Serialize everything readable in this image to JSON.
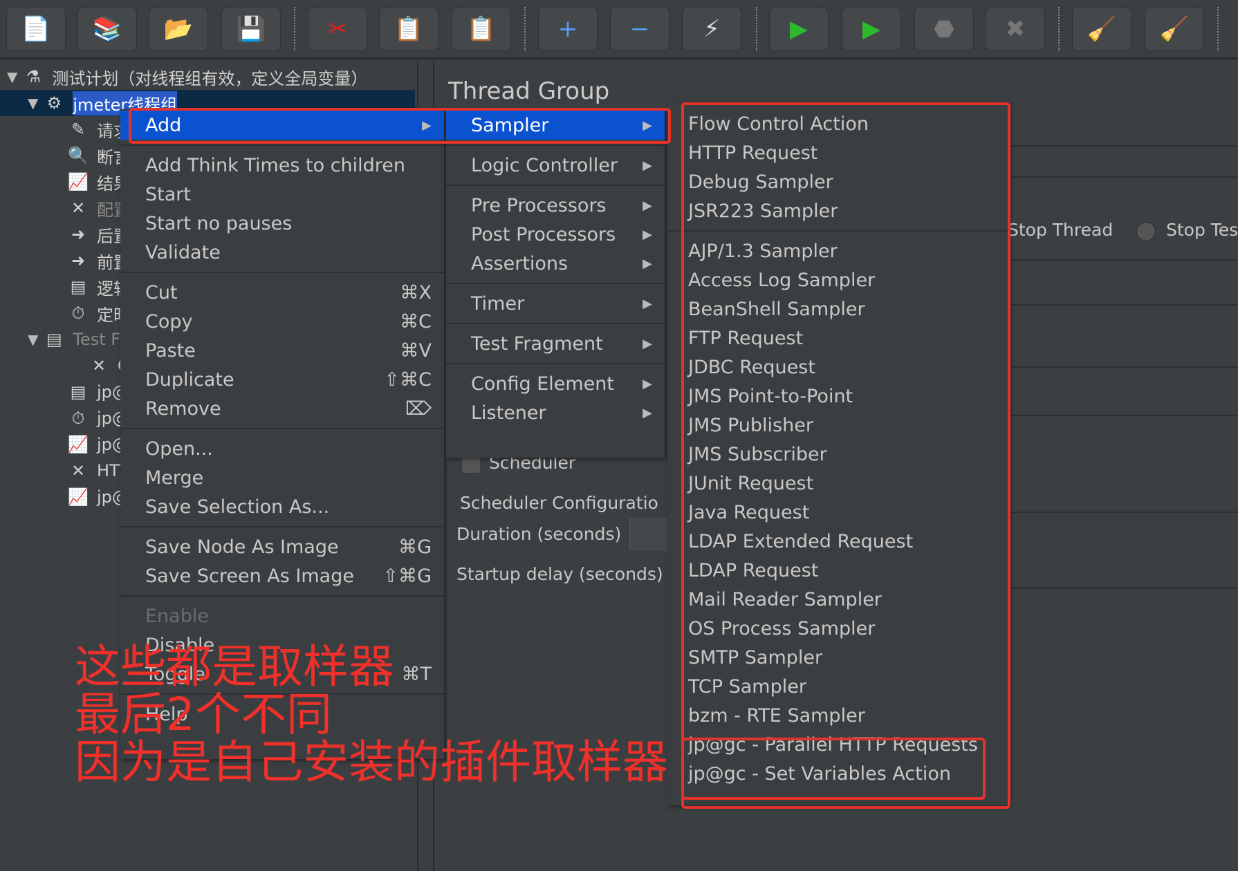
{
  "toolbar": {
    "buttons": [
      {
        "icon": "new-file-icon",
        "glyph": "📄"
      },
      {
        "icon": "templates-icon",
        "glyph": "📚"
      },
      {
        "icon": "open-icon",
        "glyph": "📂"
      },
      {
        "icon": "save-icon",
        "glyph": "💾"
      },
      {
        "icon": "cut-icon",
        "glyph": "✂"
      },
      {
        "icon": "copy-icon",
        "glyph": "📋"
      },
      {
        "icon": "paste-icon",
        "glyph": "📋"
      },
      {
        "icon": "expand-icon",
        "glyph": "+"
      },
      {
        "icon": "collapse-icon",
        "glyph": "−"
      },
      {
        "icon": "toggle-icon",
        "glyph": "⚡"
      },
      {
        "icon": "start-icon",
        "glyph": "▶"
      },
      {
        "icon": "start-no-pause-icon",
        "glyph": "▶"
      },
      {
        "icon": "stop-icon",
        "glyph": "⬣"
      },
      {
        "icon": "shutdown-icon",
        "glyph": "✖"
      },
      {
        "icon": "clear-icon",
        "glyph": "🧹"
      },
      {
        "icon": "clear-all-icon",
        "glyph": "🧹"
      }
    ]
  },
  "tree": {
    "items": [
      {
        "label": "测试计划（对线程组有效，定义全局变量）",
        "icon": "test-plan-icon",
        "glyph": "⚗",
        "arrow": "▼",
        "indent": 0
      },
      {
        "label": "jmeter线程组",
        "icon": "thread-group-gear-icon",
        "glyph": "⚙",
        "arrow": "▼",
        "indent": 1,
        "selected": true
      },
      {
        "label": "请求",
        "icon": "sampler-pen-icon",
        "glyph": "✎",
        "indent": 2
      },
      {
        "label": "断言",
        "icon": "assertion-magnifier-icon",
        "glyph": "🔍",
        "indent": 2
      },
      {
        "label": "结果树",
        "icon": "listener-chart-icon",
        "glyph": "📈",
        "indent": 2
      },
      {
        "label": "配置元",
        "icon": "config-tools-icon",
        "glyph": "✕",
        "indent": 2,
        "disabled": true
      },
      {
        "label": "后置处",
        "icon": "post-processor-icon",
        "glyph": "➜",
        "indent": 2
      },
      {
        "label": "前置处",
        "icon": "pre-processor-icon",
        "glyph": "➜",
        "indent": 2
      },
      {
        "label": "逻辑控",
        "icon": "logic-controller-icon",
        "glyph": "▤",
        "indent": 2
      },
      {
        "label": "定时器",
        "icon": "timer-icon",
        "glyph": "⏱",
        "indent": 2
      },
      {
        "label": "Test F",
        "icon": "test-fragment-icon",
        "glyph": "▤",
        "arrow": "▼",
        "indent": 1,
        "disabled": true
      },
      {
        "label": "CSV",
        "icon": "config-tools-icon",
        "glyph": "✕",
        "indent": 3
      },
      {
        "label": "jp@gc",
        "icon": "logic-controller-icon",
        "glyph": "▤",
        "indent": 2
      },
      {
        "label": "jp@gc",
        "icon": "timer-icon",
        "glyph": "⏱",
        "indent": 2
      },
      {
        "label": "jp@gc",
        "icon": "listener-chart-icon",
        "glyph": "📈",
        "indent": 2
      },
      {
        "label": "HTTP",
        "icon": "config-tools-icon",
        "glyph": "✕",
        "indent": 2
      },
      {
        "label": "jp@gc",
        "icon": "listener-chart-icon",
        "glyph": "📈",
        "indent": 2
      }
    ]
  },
  "right": {
    "title": "Thread Group",
    "stop_thread": "Stop Thread",
    "stop_test": "Stop Tes",
    "scheduler": "Scheduler",
    "scheduler_config": "Scheduler Configuratio",
    "duration": "Duration (seconds)",
    "startup_delay": "Startup delay (seconds)"
  },
  "context_menu": {
    "items": [
      {
        "label": "Add",
        "submenu": true,
        "highlight": true
      },
      {
        "sep": true
      },
      {
        "label": "Add Think Times to children"
      },
      {
        "label": "Start"
      },
      {
        "label": "Start no pauses"
      },
      {
        "label": "Validate"
      },
      {
        "sep": true
      },
      {
        "label": "Cut",
        "shortcut": "⌘X"
      },
      {
        "label": "Copy",
        "shortcut": "⌘C"
      },
      {
        "label": "Paste",
        "shortcut": "⌘V"
      },
      {
        "label": "Duplicate",
        "shortcut": "⇧⌘C"
      },
      {
        "label": "Remove",
        "shortcut": "⌦"
      },
      {
        "sep": true
      },
      {
        "label": "Open..."
      },
      {
        "label": "Merge"
      },
      {
        "label": "Save Selection As..."
      },
      {
        "sep": true
      },
      {
        "label": "Save Node As Image",
        "shortcut": "⌘G"
      },
      {
        "label": "Save Screen As Image",
        "shortcut": "⇧⌘G"
      },
      {
        "sep": true
      },
      {
        "label": "Enable",
        "disabled": true
      },
      {
        "label": "Disable"
      },
      {
        "label": "Toggle",
        "shortcut": "⌘T"
      },
      {
        "sep": true
      },
      {
        "label": "Help"
      }
    ]
  },
  "add_submenu": {
    "items": [
      {
        "label": "Sampler",
        "submenu": true,
        "highlight": true
      },
      {
        "sep": true
      },
      {
        "label": "Logic Controller",
        "submenu": true
      },
      {
        "sep": true
      },
      {
        "label": "Pre Processors",
        "submenu": true
      },
      {
        "label": "Post Processors",
        "submenu": true
      },
      {
        "label": "Assertions",
        "submenu": true
      },
      {
        "sep": true
      },
      {
        "label": "Timer",
        "submenu": true
      },
      {
        "sep": true
      },
      {
        "label": "Test Fragment",
        "submenu": true
      },
      {
        "sep": true
      },
      {
        "label": "Config Element",
        "submenu": true
      },
      {
        "label": "Listener",
        "submenu": true
      }
    ]
  },
  "sampler_submenu": {
    "items": [
      {
        "label": "Flow Control Action"
      },
      {
        "label": "HTTP Request"
      },
      {
        "label": "Debug Sampler"
      },
      {
        "label": "JSR223 Sampler"
      },
      {
        "sep": true
      },
      {
        "label": "AJP/1.3 Sampler"
      },
      {
        "label": "Access Log Sampler"
      },
      {
        "label": "BeanShell Sampler"
      },
      {
        "label": "FTP Request"
      },
      {
        "label": "JDBC Request"
      },
      {
        "label": "JMS Point-to-Point"
      },
      {
        "label": "JMS Publisher"
      },
      {
        "label": "JMS Subscriber"
      },
      {
        "label": "JUnit Request"
      },
      {
        "label": "Java Request"
      },
      {
        "label": "LDAP Extended Request"
      },
      {
        "label": "LDAP Request"
      },
      {
        "label": "Mail Reader Sampler"
      },
      {
        "label": "OS Process Sampler"
      },
      {
        "label": "SMTP Sampler"
      },
      {
        "label": "TCP Sampler"
      },
      {
        "label": "bzm - RTE Sampler"
      },
      {
        "label": "jp@gc - Parallel HTTP Requests"
      },
      {
        "label": "jp@gc - Set Variables Action"
      }
    ]
  },
  "annotation": {
    "lines": [
      "这些都是取样器",
      "最后2个不同",
      "因为是自己安装的插件取样器"
    ]
  },
  "colors": {
    "highlight": "#0b52d0",
    "annotation": "#f0302a",
    "background": "#3c3f41"
  }
}
